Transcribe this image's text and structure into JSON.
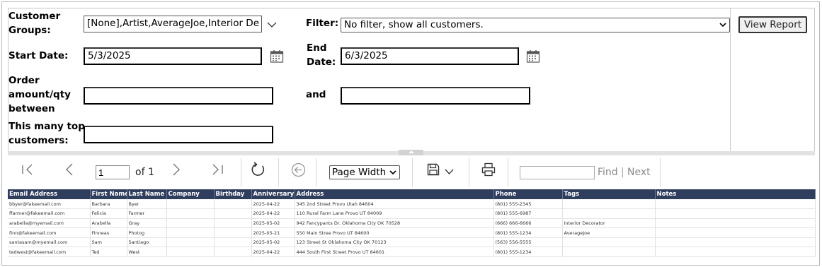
{
  "params": {
    "customer_groups_label_1": "Customer",
    "customer_groups_label_2": "Groups:",
    "customer_groups_value": "[None],Artist,AverageJoe,Interior De",
    "filter_label": "Filter:",
    "filter_value": "No filter, show all customers.",
    "start_date_label": "Start Date:",
    "start_date_value": "5/3/2025",
    "end_date_label_1": "End",
    "end_date_label_2": "Date:",
    "end_date_value": "6/3/2025",
    "order_label_1": "Order",
    "order_label_2": "amount/qty",
    "order_label_3": "between",
    "order_min_value": "",
    "and_label": "and",
    "order_max_value": "",
    "top_label_1": "This many top",
    "top_label_2": "customers:",
    "top_value": "",
    "view_report_label": "View Report"
  },
  "toolbar": {
    "page_value": "1",
    "of_label": "of 1",
    "zoom_value": "Page Width",
    "find_value": "",
    "find_label": "Find",
    "find_separator": "|",
    "next_label": "Next"
  },
  "report": {
    "columns": [
      "Email Address",
      "First Name",
      "Last Name",
      "Company",
      "Birthday",
      "Anniversary",
      "Address",
      "Phone",
      "Tags",
      "Notes"
    ],
    "rows": [
      [
        "bbyer@fakeemail.com",
        "Barbara",
        "Byer",
        "",
        "",
        "2025-04-22",
        "345 2nd Street  Provo  Utah  84604",
        "(801) 555-2345",
        "",
        ""
      ],
      [
        "ffarmer@fakeemail.com",
        "Felicia",
        "Farmer",
        "",
        "",
        "2025-04-22",
        "110 Rural Farm Lane  Provo  UT  84009",
        "(801) 555-6987",
        "",
        ""
      ],
      [
        "arabella@myemail.com",
        "Arabella",
        "Gray",
        "",
        "",
        "2025-05-02",
        "942 Fancypants Dr.  Oklahoma City  OK  70528",
        "(666) 666-6666",
        "Interior Decorator",
        ""
      ],
      [
        "finn@fakeemail.com",
        "Finneas",
        "Photog",
        "",
        "",
        "2025-05-21",
        "550 Main Stree  Provo  UT  84600",
        "(801) 555-1234",
        "AverageJoe",
        ""
      ],
      [
        "santasam@myemail.com",
        "Sam",
        "Santiago",
        "",
        "",
        "2025-05-02",
        "123 Street St  Oklahoma City  OK  70123",
        "(563) 556-5555",
        "",
        ""
      ],
      [
        "tedwest@fakeemail.com",
        "Ted",
        "West",
        "",
        "",
        "2025-04-22",
        "444 South First Street  Provo  UT  84601",
        "(801) 555-1234",
        "",
        ""
      ]
    ]
  },
  "icons": {
    "calendar": "calendar-icon",
    "first_page": "first-page-icon",
    "prev_page": "previous-page-icon",
    "next_page": "next-page-icon",
    "last_page": "last-page-icon",
    "refresh": "refresh-icon",
    "back": "back-icon",
    "save": "save-icon",
    "print": "print-icon"
  },
  "colors": {
    "header_bg": "#2f3e5d",
    "header_text": "#ffffff"
  }
}
